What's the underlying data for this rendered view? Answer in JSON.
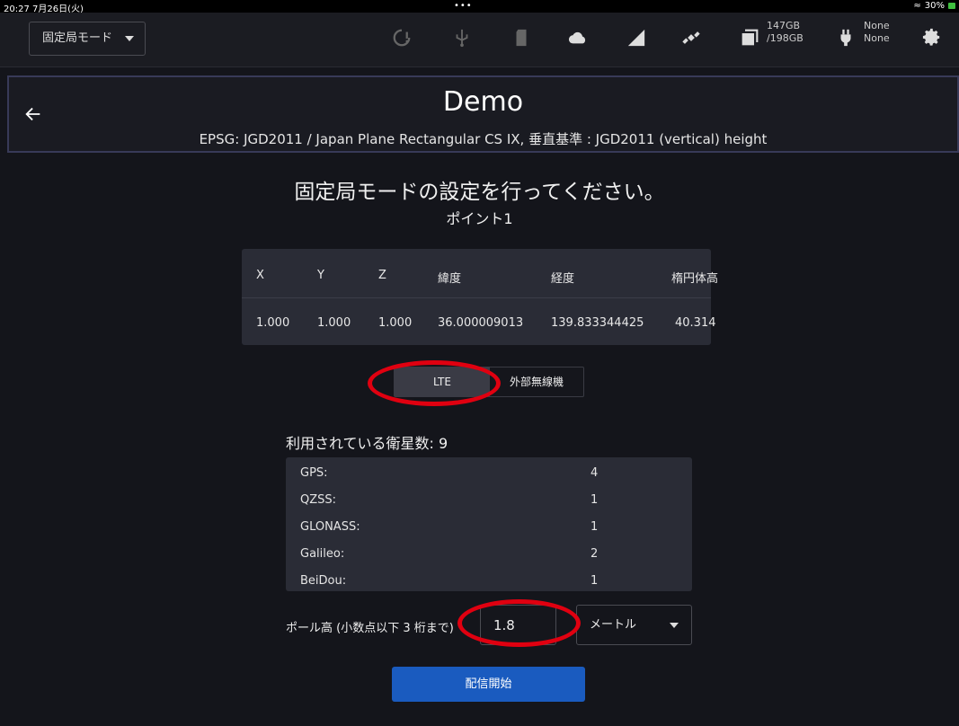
{
  "status_bar": {
    "time": "20:27",
    "date": "7月26日(火)",
    "dots": "•••",
    "battery": "30%"
  },
  "toolbar": {
    "mode_select": "固定局モード",
    "storage_line1": "147GB",
    "storage_line2": "/198GB",
    "power_line1": "None",
    "power_line2": "None",
    "icons": [
      "gauge-alert-icon",
      "usb-icon",
      "sd-card-icon",
      "cloud-icon",
      "signal-icon",
      "satellite-icon",
      "storage-icon",
      "plug-icon",
      "gear-icon"
    ]
  },
  "header": {
    "title": "Demo",
    "subtitle": "EPSG: JGD2011 / Japan Plane Rectangular CS IX, 垂直基準 : JGD2011 (vertical) height"
  },
  "main": {
    "instruction": "固定局モードの設定を行ってください。",
    "point_label": "ポイント1",
    "coord_table": {
      "headers": [
        "X",
        "Y",
        "Z",
        "緯度",
        "経度",
        "楕円体高"
      ],
      "row": [
        "1.000",
        "1.000",
        "1.000",
        "36.000009013",
        "139.833344425",
        "40.314"
      ]
    },
    "toggle": {
      "option1": "LTE",
      "option2": "外部無線機",
      "selected": "LTE"
    },
    "satellites_label": "利用されている衛星数: 9",
    "satellites": [
      {
        "name": "GPS:",
        "count": "4"
      },
      {
        "name": "QZSS:",
        "count": "1"
      },
      {
        "name": "GLONASS:",
        "count": "1"
      },
      {
        "name": "Galileo:",
        "count": "2"
      },
      {
        "name": "BeiDou:",
        "count": "1"
      }
    ],
    "pole_label": "ポール高 (小数点以下 3 桁まで)",
    "pole_value": "1.8",
    "unit": "メートル",
    "start_button": "配信開始"
  },
  "colors": {
    "background": "#14151b",
    "panel": "#2a2c36",
    "accent": "#1a5bbf",
    "annotation": "#e00010"
  }
}
